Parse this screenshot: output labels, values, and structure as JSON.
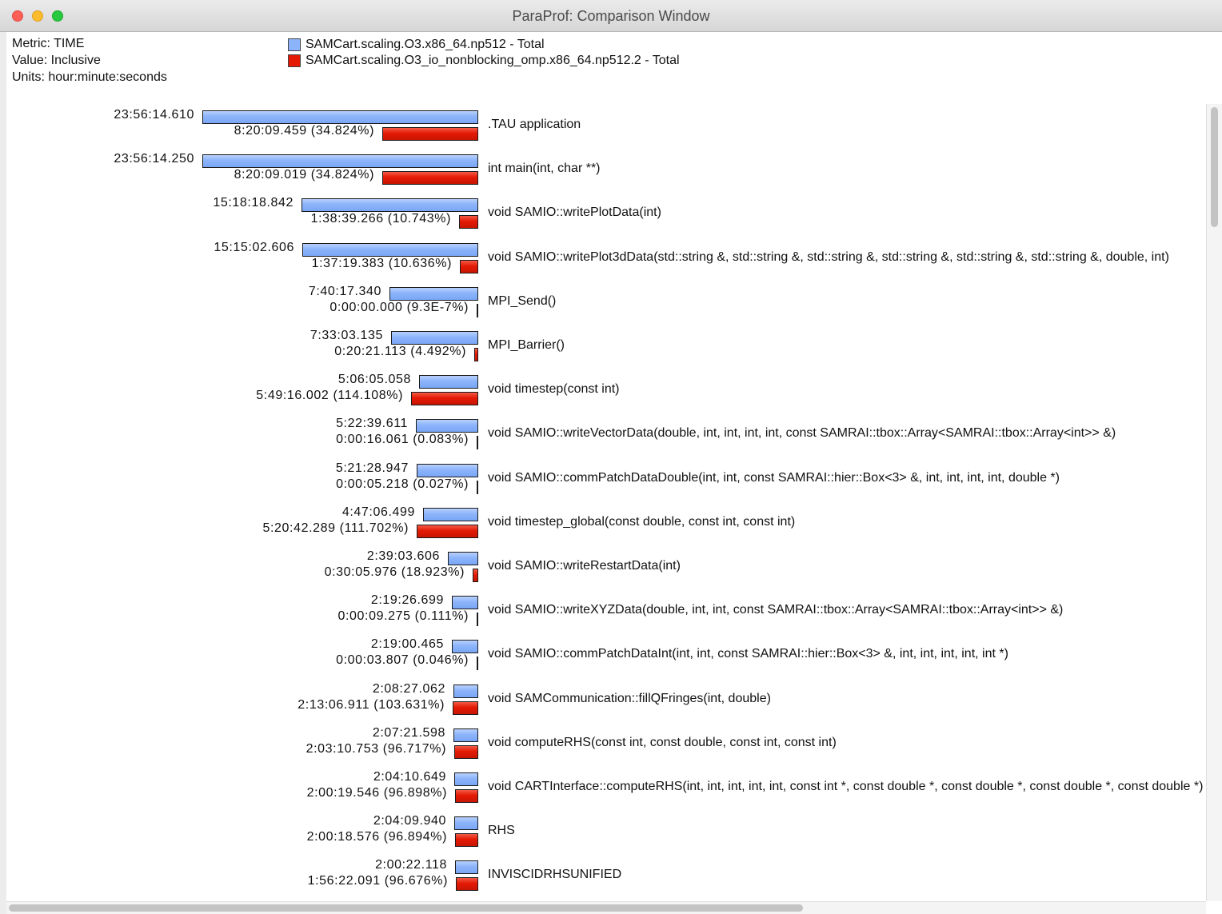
{
  "window": {
    "title": "ParaProf: Comparison Window"
  },
  "info": {
    "metric": "Metric: TIME",
    "value": "Value: Inclusive",
    "units": "Units: hour:minute:seconds"
  },
  "legend": [
    {
      "label": "SAMCart.scaling.O3.x86_64.np512 - Total",
      "color": "#8cb4fb"
    },
    {
      "label": "SAMCart.scaling.O3_io_nonblocking_omp.x86_64.np512.2 - Total",
      "color": "#e41a05"
    }
  ],
  "colors": {
    "baseline": "#8cb4fb",
    "comparison": "#e41a05"
  },
  "chart_data": {
    "type": "bar",
    "max_value_seconds": 86174.61,
    "rows": [
      {
        "name": ".TAU application",
        "base_label": "23:56:14.610",
        "base_seconds": 86174.61,
        "comp_label": "8:20:09.459 (34.824%)",
        "comp_seconds": 30009.459
      },
      {
        "name": "int main(int, char **)",
        "base_label": "23:56:14.250",
        "base_seconds": 86174.25,
        "comp_label": "8:20:09.019 (34.824%)",
        "comp_seconds": 30009.019
      },
      {
        "name": "void SAMIO::writePlotData(int)",
        "base_label": "15:18:18.842",
        "base_seconds": 55098.842,
        "comp_label": "1:38:39.266 (10.743%)",
        "comp_seconds": 5919.266
      },
      {
        "name": "void SAMIO::writePlot3dData(std::string &, std::string &, std::string &, std::string &, std::string &, std::string &, double, int)",
        "base_label": "15:15:02.606",
        "base_seconds": 54902.606,
        "comp_label": "1:37:19.383 (10.636%)",
        "comp_seconds": 5839.383
      },
      {
        "name": "MPI_Send()",
        "base_label": "7:40:17.340",
        "base_seconds": 27617.34,
        "comp_label": "0:00:00.000 (9.3E-7%)",
        "comp_seconds": 0.0
      },
      {
        "name": "MPI_Barrier()",
        "base_label": "7:33:03.135",
        "base_seconds": 27183.135,
        "comp_label": "0:20:21.113 (4.492%)",
        "comp_seconds": 1221.113
      },
      {
        "name": "void timestep(const int)",
        "base_label": "5:06:05.058",
        "base_seconds": 18365.058,
        "comp_label": "5:49:16.002 (114.108%)",
        "comp_seconds": 20956.002
      },
      {
        "name": "void SAMIO::writeVectorData(double, int, int, int, int, const SAMRAI::tbox::Array<SAMRAI::tbox::Array<int>> &)",
        "base_label": "5:22:39.611",
        "base_seconds": 19359.611,
        "comp_label": "0:00:16.061 (0.083%)",
        "comp_seconds": 16.061
      },
      {
        "name": "void SAMIO::commPatchDataDouble(int, int, const SAMRAI::hier::Box<3> &, int, int, int, int, double *)",
        "base_label": "5:21:28.947",
        "base_seconds": 19288.947,
        "comp_label": "0:00:05.218 (0.027%)",
        "comp_seconds": 5.218
      },
      {
        "name": "void timestep_global(const double, const int, const int)",
        "base_label": "4:47:06.499",
        "base_seconds": 17226.499,
        "comp_label": "5:20:42.289 (111.702%)",
        "comp_seconds": 19242.289
      },
      {
        "name": "void SAMIO::writeRestartData(int)",
        "base_label": "2:39:03.606",
        "base_seconds": 9543.606,
        "comp_label": "0:30:05.976 (18.923%)",
        "comp_seconds": 1805.976
      },
      {
        "name": "void SAMIO::writeXYZData(double, int, int, const SAMRAI::tbox::Array<SAMRAI::tbox::Array<int>> &)",
        "base_label": "2:19:26.699",
        "base_seconds": 8366.699,
        "comp_label": "0:00:09.275 (0.111%)",
        "comp_seconds": 9.275
      },
      {
        "name": "void SAMIO::commPatchDataInt(int, int, const SAMRAI::hier::Box<3> &, int, int, int, int, int *)",
        "base_label": "2:19:00.465",
        "base_seconds": 8340.465,
        "comp_label": "0:00:03.807 (0.046%)",
        "comp_seconds": 3.807
      },
      {
        "name": "void SAMCommunication::fillQFringes(int, double)",
        "base_label": "2:08:27.062",
        "base_seconds": 7707.062,
        "comp_label": "2:13:06.911 (103.631%)",
        "comp_seconds": 7986.911
      },
      {
        "name": "void computeRHS(const int, const double, const int, const int)",
        "base_label": "2:07:21.598",
        "base_seconds": 7641.598,
        "comp_label": "2:03:10.753 (96.717%)",
        "comp_seconds": 7390.753
      },
      {
        "name": "void CARTInterface::computeRHS(int, int, int, int, int, const int *, const double *, const double *, const double *, const double *)",
        "base_label": "2:04:10.649",
        "base_seconds": 7450.649,
        "comp_label": "2:00:19.546 (96.898%)",
        "comp_seconds": 7219.546
      },
      {
        "name": "RHS",
        "base_label": "2:04:09.940",
        "base_seconds": 7449.94,
        "comp_label": "2:00:18.576 (96.894%)",
        "comp_seconds": 7218.576
      },
      {
        "name": "INVISCIDRHSUNIFIED",
        "base_label": "2:00:22.118",
        "base_seconds": 7222.118,
        "comp_label": "1:56:22.091 (96.676%)",
        "comp_seconds": 6982.091
      }
    ]
  }
}
